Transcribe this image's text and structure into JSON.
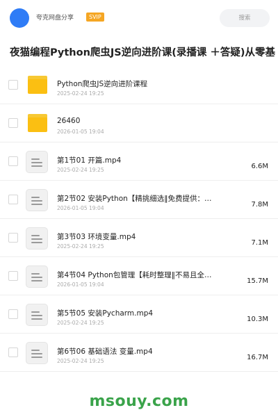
{
  "header": {
    "app_name": "夸克网盘分享",
    "badge": "SVIP",
    "search_label": "搜索"
  },
  "title": "夜猫编程Python爬虫JS逆向进阶课(录播课 ＋答疑)从零基",
  "files": [
    {
      "type": "folder",
      "name": "Python爬虫JS逆向进阶课程",
      "date": "2025-02-24 19:25",
      "size": ""
    },
    {
      "type": "folder",
      "name": "26460",
      "date": "2026-01-05 19:04",
      "size": ""
    },
    {
      "type": "file",
      "name": "第1节01 开篇.mp4",
      "date": "2025-02-24 19:25",
      "size": "6.6M"
    },
    {
      "type": "file",
      "name": "第2节02 安装Python【精挑细选‖免费提供：…",
      "date": "2026-01-05 19:04",
      "size": "7.8M"
    },
    {
      "type": "file",
      "name": "第3节03 环境变量.mp4",
      "date": "2025-02-24 19:25",
      "size": "7.1M"
    },
    {
      "type": "file",
      "name": "第4节04 Python包管理【耗时整理‖不易且全…",
      "date": "2026-01-05 19:04",
      "size": "15.7M"
    },
    {
      "type": "file",
      "name": "第5节05 安装Pycharm.mp4",
      "date": "2025-02-24 19:25",
      "size": "10.3M"
    },
    {
      "type": "file",
      "name": "第6节06 基础语法 变量.mp4",
      "date": "2025-02-24 19:25",
      "size": "16.7M"
    }
  ],
  "watermark": "msouy.com",
  "colors": {
    "avatar": "#2f7cf6",
    "badge": "#f5a623",
    "folder": "#fbbf12",
    "watermark": "#3aa34a"
  }
}
